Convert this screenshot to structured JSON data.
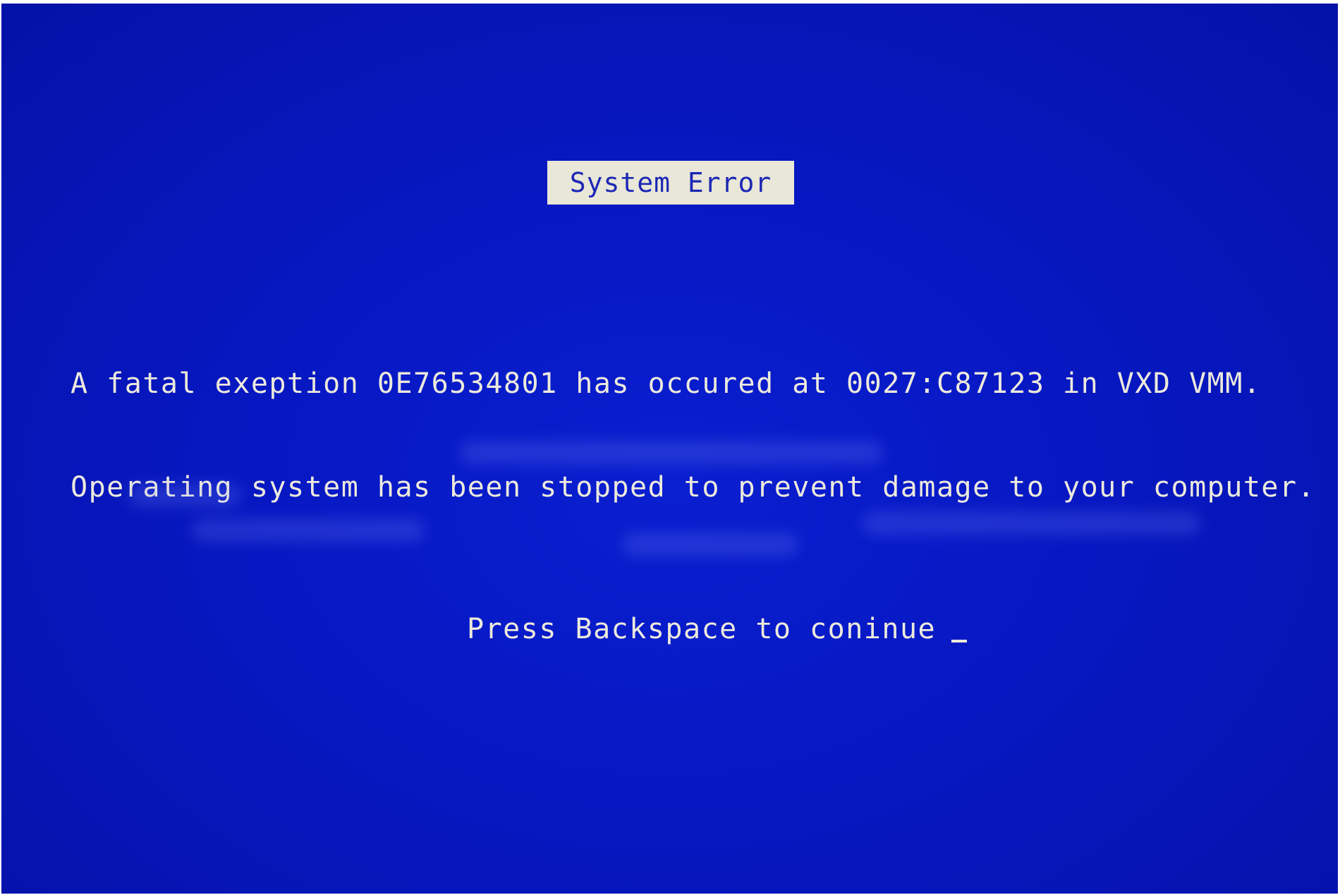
{
  "screen": {
    "title": "System Error",
    "message_lines": [
      "A fatal exeption 0E76534801 has occured at 0027:C87123 in VXD VMM.",
      "Operating system has been stopped to prevent damage to your computer."
    ],
    "prompt": "Press Backspace to coninue"
  },
  "colors": {
    "background": "#0718c2",
    "text": "#ece9dc",
    "title_box": "#e9e7d8",
    "title_text": "#1c28b4"
  }
}
